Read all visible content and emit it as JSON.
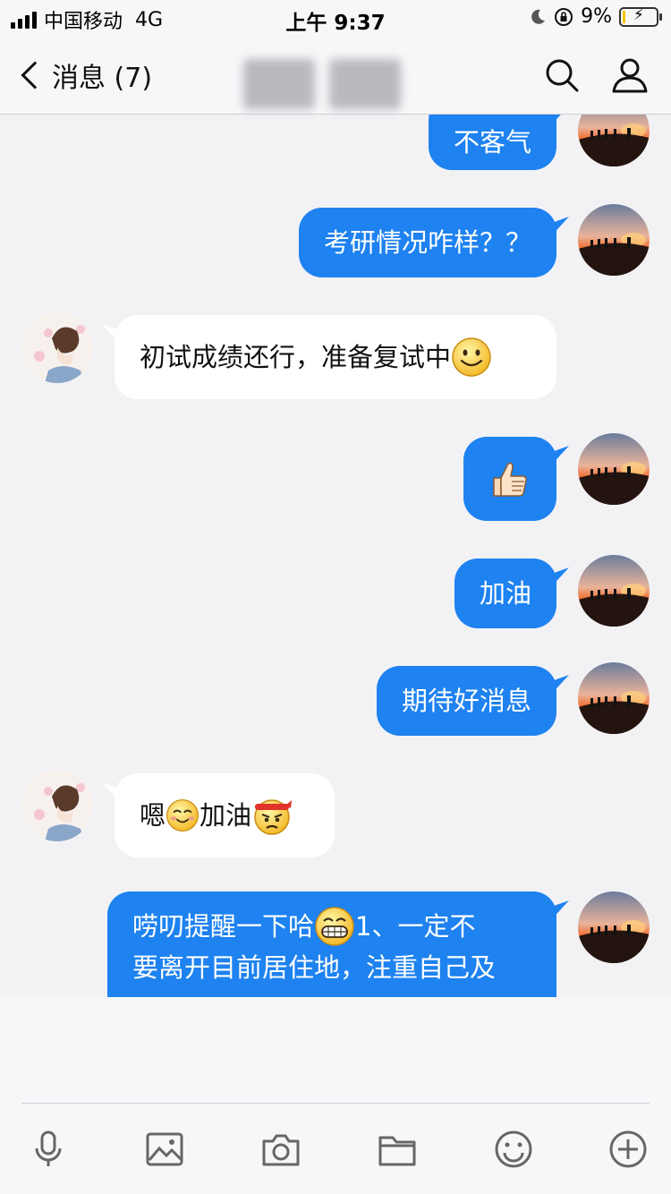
{
  "status_bar": {
    "carrier": "中国移动",
    "network": "4G",
    "time": "上午 9:37",
    "battery": "9%",
    "battery_level": 0.09
  },
  "nav": {
    "back_label": "消息 (7)"
  },
  "messages": [
    {
      "from": "me",
      "text": "不客气"
    },
    {
      "from": "me",
      "text": "考研情况咋样？？"
    },
    {
      "from": "friend",
      "text": "初试成绩还行，准备复试中",
      "trailing_emoji": "smile-emoji"
    },
    {
      "from": "me",
      "emoji": "thumbs-up-emoji"
    },
    {
      "from": "me",
      "text": "加油"
    },
    {
      "from": "me",
      "text": "期待好消息"
    },
    {
      "from": "friend",
      "text_before": "嗯",
      "mid_emoji": "blush-emoji",
      "text_after": "加油",
      "trailing_emoji": "determined-emoji"
    },
    {
      "from": "me",
      "line1_before": "唠叨提醒一下哈",
      "inline_emoji": "grin-emoji",
      "line1_after": "1、一定不",
      "line2": "要离开目前居住地，注重自己及"
    }
  ],
  "toolbar": {
    "items": [
      "microphone-icon",
      "image-icon",
      "camera-icon",
      "folder-icon",
      "emoji-icon",
      "plus-icon"
    ]
  },
  "colors": {
    "outgoing_bubble": "#1e82f0",
    "incoming_bubble": "#ffffff",
    "background": "#f2f2f5"
  }
}
